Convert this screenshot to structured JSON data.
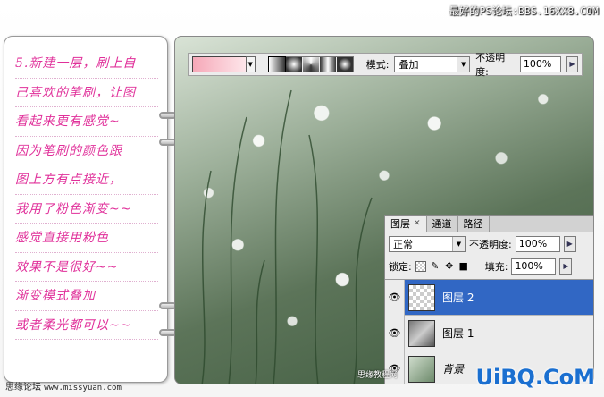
{
  "watermark_top": "最好的PS论坛:BBS.16XX8.COM",
  "notebook": {
    "lines": [
      "5.新建一层，刷上自",
      "己喜欢的笔刷，让图",
      "看起来更有感觉~",
      "因为笔刷的颜色跟",
      "图上方有点接近，",
      "我用了粉色渐变~~",
      "感觉直接用粉色",
      "效果不是很好~~",
      "渐变模式叠加",
      "或者柔光都可以~~"
    ],
    "footer_label": "思缘论坛",
    "footer_url": "www.missyuan.com"
  },
  "toolbar": {
    "mode_label": "模式:",
    "mode_value": "叠加",
    "opacity_label": "不透明度:",
    "opacity_value": "100%",
    "gradient_colors": [
      "#f6a8b8",
      "#fde6ea"
    ]
  },
  "layers_panel": {
    "tabs": [
      {
        "label": "图层",
        "active": true
      },
      {
        "label": "通道",
        "active": false
      },
      {
        "label": "路径",
        "active": false
      }
    ],
    "blend_mode": "正常",
    "opacity_label": "不透明度:",
    "opacity_value": "100%",
    "lock_label": "锁定:",
    "fill_label": "填充:",
    "fill_value": "100%",
    "layers": [
      {
        "name": "图层 2",
        "selected": true,
        "thumb": "transparent"
      },
      {
        "name": "图层 1",
        "selected": false,
        "thumb": "noise"
      },
      {
        "name": "背景",
        "selected": false,
        "thumb": "photo"
      }
    ]
  },
  "uibq_watermark": "UiBQ.CoM",
  "stamp_text": "思缘教程网"
}
